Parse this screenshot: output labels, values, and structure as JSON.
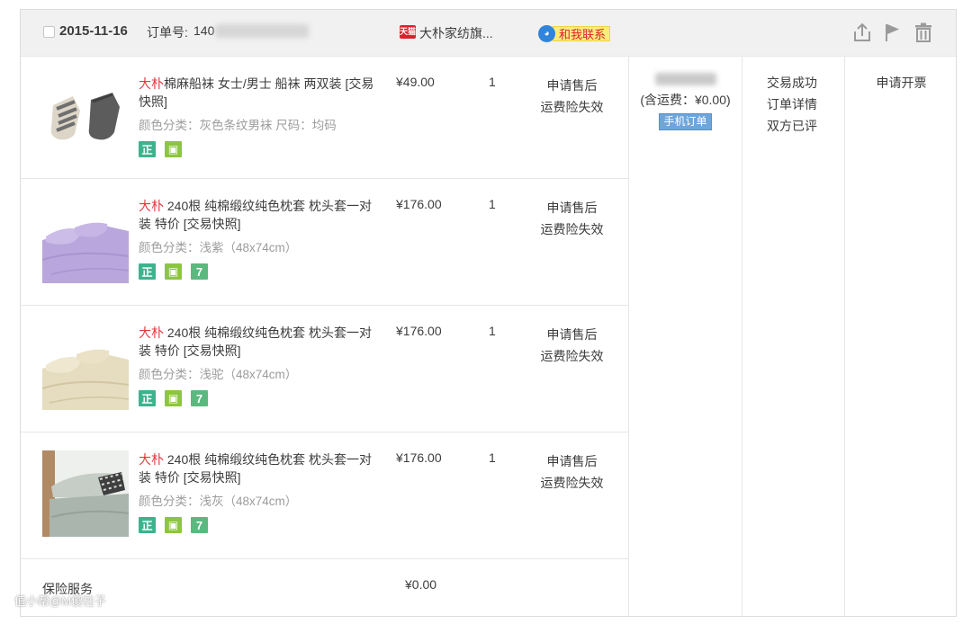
{
  "header": {
    "date": "2015-11-16",
    "order_label": "订单号:",
    "order_no_visible": "140",
    "shop_badge": "天猫",
    "shop_name": "大朴家纺旗...",
    "contact_label": "和我联系",
    "actions": [
      "share-icon",
      "flag-icon",
      "trash-icon"
    ]
  },
  "items": [
    {
      "brand": "大朴",
      "title": "棉麻船袜 女士/男士 船袜 两双装 [交易快照]",
      "sku": "颜色分类：灰色条纹男袜   尺码：均码",
      "price": "¥49.00",
      "qty": "1",
      "service_1": "申请售后",
      "service_2": "运费险失效",
      "badges": [
        "正",
        "保"
      ],
      "image": "socks"
    },
    {
      "brand": "大朴",
      "title": " 240根 纯棉缎纹纯色枕套 枕头套一对装 特价 [交易快照]",
      "sku": "颜色分类：浅紫（48x74cm）",
      "price": "¥176.00",
      "qty": "1",
      "service_1": "申请售后",
      "service_2": "运费险失效",
      "badges": [
        "正",
        "保",
        "7"
      ],
      "image": "bedding-purple"
    },
    {
      "brand": "大朴",
      "title": " 240根 纯棉缎纹纯色枕套 枕头套一对装 特价 [交易快照]",
      "sku": "颜色分类：浅驼（48x74cm）",
      "price": "¥176.00",
      "qty": "1",
      "service_1": "申请售后",
      "service_2": "运费险失效",
      "badges": [
        "正",
        "保",
        "7"
      ],
      "image": "bedding-camel"
    },
    {
      "brand": "大朴",
      "title": " 240根 纯棉缎纹纯色枕套 枕头套一对装 特价 [交易快照]",
      "sku": "颜色分类：浅灰（48x74cm）",
      "price": "¥176.00",
      "qty": "1",
      "service_1": "申请售后",
      "service_2": "运费险失效",
      "badges": [
        "正",
        "保",
        "7"
      ],
      "image": "bedding-grey"
    }
  ],
  "payment": {
    "shipping_note": "(含运费：¥0.00)",
    "mobile_tag": "手机订单"
  },
  "status": {
    "line1": "交易成功",
    "line2": "订单详情",
    "line3": "双方已评"
  },
  "invoice_label": "申请开票",
  "insurance": {
    "label": "保险服务",
    "price": "¥0.00"
  },
  "watermark": "值小帮@M傻柱子",
  "colors": {
    "brand_red": "#e4393c",
    "badge_green": "#3db38d",
    "header_bg": "#f1f1f1",
    "mobile_tag_bg": "#6ea5db"
  }
}
